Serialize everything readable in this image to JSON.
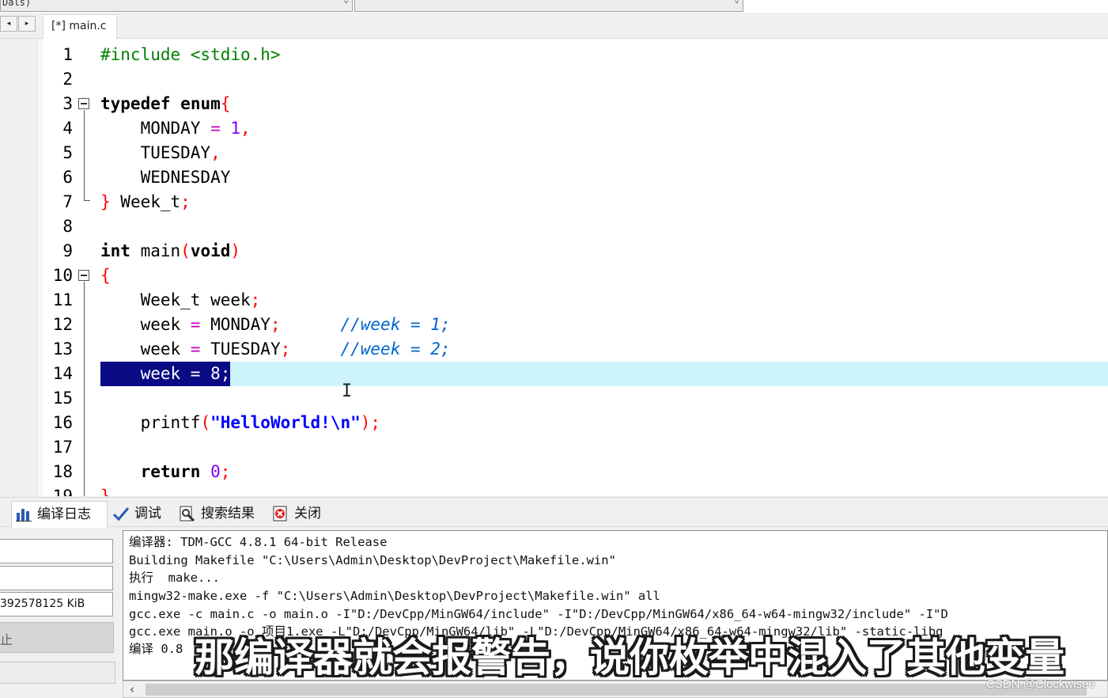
{
  "top_bar": {
    "combo_left_text": "Dals)"
  },
  "tabs": {
    "nav_prev": "◂",
    "nav_next": "▸",
    "editor_tab_label": "[*] main.c"
  },
  "editor": {
    "line_numbers": [
      "1",
      "2",
      "3",
      "4",
      "5",
      "6",
      "7",
      "8",
      "9",
      "10",
      "11",
      "12",
      "13",
      "14",
      "15",
      "16",
      "17",
      "18",
      "19"
    ]
  },
  "bottom_tabs": [
    {
      "label": "编译日志",
      "icon": "chart-icon"
    },
    {
      "label": "调试",
      "icon": "checkmark-icon"
    },
    {
      "label": "搜索结果",
      "icon": "search-doc-icon"
    },
    {
      "label": "关闭",
      "icon": "close-doc-icon"
    }
  ],
  "bottom_left": {
    "field3_value": "392578125 KiB",
    "button_label": "止"
  },
  "compile_log": [
    "编译器: TDM-GCC 4.8.1 64-bit Release",
    "Building Makefile \"C:\\Users\\Admin\\Desktop\\DevProject\\Makefile.win\"",
    "执行  make...",
    "mingw32-make.exe -f \"C:\\Users\\Admin\\Desktop\\DevProject\\Makefile.win\" all",
    "gcc.exe -c main.c -o main.o -I\"D:/DevCpp/MinGW64/include\" -I\"D:/DevCpp/MinGW64/x86_64-w64-mingw32/include\" -I\"D",
    "gcc.exe main.o -o 项目1.exe -L\"D:/DevCpp/MinGW64/lib\" -L\"D:/DevCpp/MinGW64/x86_64-w64-mingw32/lib\" -static-libg",
    "编译 0.8"
  ],
  "overlay": {
    "subtitle": "那编译器就会报警告，说你枚举中混入了其他变量",
    "watermark": "CSDN @Clockwisee"
  },
  "colors": {
    "selection": "#0a0a84",
    "current_line": "#cdf3fb",
    "comment": "#0066cc",
    "string": "#0000ff",
    "brace": "#ff0000",
    "number": "#8000ff",
    "preprocessor": "#008000"
  }
}
